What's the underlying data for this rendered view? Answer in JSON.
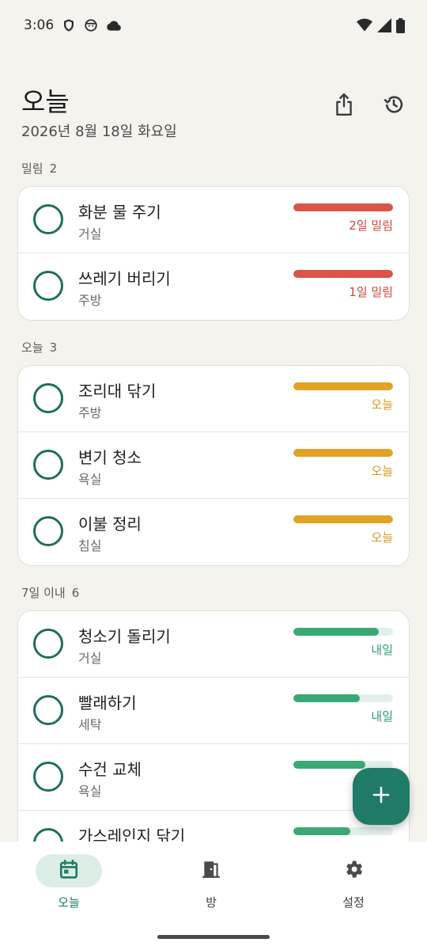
{
  "status_bar": {
    "time": "3:06",
    "icons": [
      "shield-icon",
      "face-icon",
      "cloud-icon",
      "wifi-icon",
      "signal-icon",
      "battery-icon"
    ]
  },
  "header": {
    "title": "오늘",
    "date": "2026년 8월 18일 화요일",
    "actions": [
      "share-icon",
      "history-icon"
    ]
  },
  "sections": [
    {
      "label": "밀림",
      "count": "2",
      "tasks": [
        {
          "name": "화분 물 주기",
          "room": "거실",
          "status": "2일 밀림",
          "progress": 1.0,
          "color": "#DB5448"
        },
        {
          "name": "쓰레기 버리기",
          "room": "주방",
          "status": "1일 밀림",
          "progress": 1.0,
          "color": "#DB5448"
        }
      ]
    },
    {
      "label": "오늘",
      "count": "3",
      "tasks": [
        {
          "name": "조리대 닦기",
          "room": "주방",
          "status": "오늘",
          "progress": 1.0,
          "color": "#E0A325"
        },
        {
          "name": "변기 청소",
          "room": "욕실",
          "status": "오늘",
          "progress": 1.0,
          "color": "#E0A325"
        },
        {
          "name": "이불 정리",
          "room": "침실",
          "status": "오늘",
          "progress": 1.0,
          "color": "#E0A325"
        }
      ]
    },
    {
      "label": "7일 이내",
      "count": "6",
      "tasks": [
        {
          "name": "청소기 돌리기",
          "room": "거실",
          "status": "내일",
          "progress": 0.86,
          "color": "#3AA874"
        },
        {
          "name": "빨래하기",
          "room": "세탁",
          "status": "내일",
          "progress": 0.67,
          "color": "#3AA874"
        },
        {
          "name": "수건 교체",
          "room": "욕실",
          "status": "",
          "progress": 0.72,
          "color": "#3AA874"
        },
        {
          "name": "가스레인지 닦기",
          "room": "",
          "status": "",
          "progress": 0.57,
          "color": "#3AA874"
        }
      ]
    }
  ],
  "fab": {
    "icon": "plus-icon"
  },
  "bottom_nav": {
    "items": [
      {
        "label": "오늘",
        "icon": "calendar-icon",
        "active": true
      },
      {
        "label": "방",
        "icon": "door-icon",
        "active": false
      },
      {
        "label": "설정",
        "icon": "gear-icon",
        "active": false
      }
    ]
  },
  "colors": {
    "accent": "#1F7A66",
    "overdue": "#DB5448",
    "today": "#E0A325",
    "upcoming": "#3AA874",
    "status_overdue_text": "#D0483D",
    "status_today_text": "#D69A1E",
    "status_upcoming_text": "#2E9B74"
  }
}
